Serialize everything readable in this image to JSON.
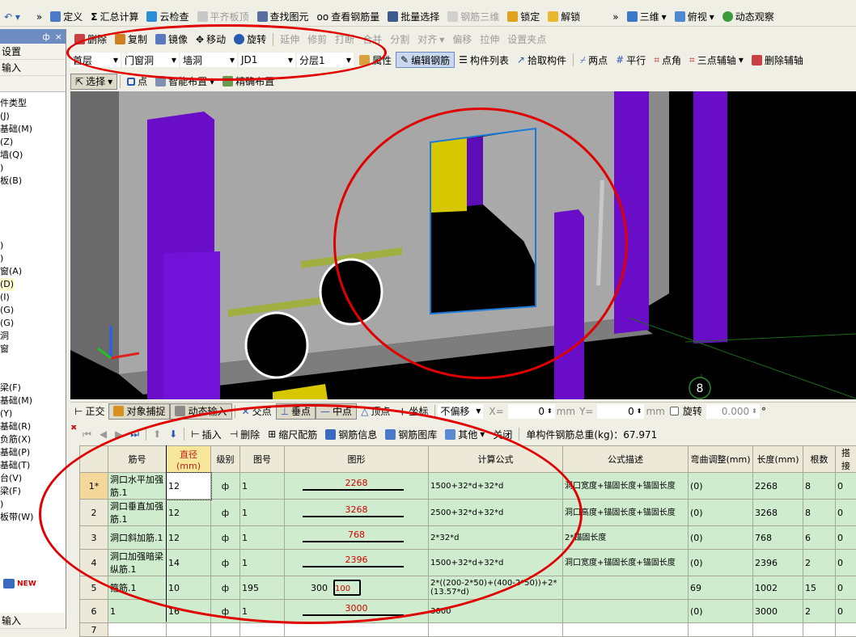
{
  "toolbar1": {
    "items": [
      "定义",
      "汇总计算",
      "云检查",
      "平齐板顶",
      "查找图元",
      "查看钢筋量",
      "批量选择",
      "钢筋三维",
      "锁定",
      "解锁"
    ],
    "view_3d": "三维",
    "view_top": "俯视",
    "view_dynamic": "动态观察"
  },
  "toolbar2": {
    "items": [
      "删除",
      "复制",
      "镜像",
      "移动",
      "旋转",
      "延伸",
      "修剪",
      "打断",
      "合并",
      "分割",
      "对齐",
      "偏移",
      "拉伸",
      "设置夹点"
    ]
  },
  "toolbar3": {
    "floor": "首层",
    "category": "门窗洞",
    "type": "墙洞",
    "element": "JD1",
    "layer": "分层1",
    "items": [
      "属性",
      "编辑钢筋",
      "构件列表",
      "拾取构件",
      "两点",
      "平行",
      "点角",
      "三点辅轴",
      "删除辅轴"
    ]
  },
  "toolbar4": {
    "select": "选择",
    "point": "点",
    "smart": "智能布置",
    "precise": "精确布置"
  },
  "left_panel": {
    "pin": "ф",
    "close": "×",
    "settings": "设置",
    "input": "输入",
    "items": [
      "件类型",
      "(J)",
      "基础(M)",
      "(Z)",
      "墙(Q)",
      ")",
      "板(B)",
      "",
      "",
      "",
      "",
      ")",
      ")",
      "窗(A)",
      "(D)",
      "(I)",
      "(G)",
      "(G)",
      "洞",
      "窗",
      "",
      "",
      "梁(F)",
      "基础(M)",
      "(Y)",
      "基础(R)",
      "负筋(X)",
      "基础(P)",
      "基础(T)",
      "台(V)",
      "梁(F)",
      ")",
      "板带(W)"
    ],
    "new_badge": "NEW",
    "bottom": "输入"
  },
  "view": {
    "axis_number": "8"
  },
  "snap_bar": {
    "items": [
      "正交",
      "对象捕捉",
      "动态输入",
      "交点",
      "垂点",
      "中点",
      "顶点",
      "坐标"
    ],
    "offset": "不偏移",
    "x_label": "X=",
    "x_value": "0",
    "y_label": "Y=",
    "y_value": "0",
    "unit": "mm",
    "rotate_label": "旋转",
    "rotate_value": "0.000",
    "degree": "°"
  },
  "rebar_toolbar": {
    "items": [
      "插入",
      "删除",
      "缩尺配筋",
      "钢筋信息",
      "钢筋图库",
      "其他",
      "关闭"
    ],
    "total_weight": "单构件钢筋总重(kg)：67.971"
  },
  "table": {
    "headers": [
      "",
      "筋号",
      "直径(mm)",
      "级别",
      "图号",
      "图形",
      "计算公式",
      "公式描述",
      "弯曲调整(mm)",
      "长度(mm)",
      "根数",
      "搭接"
    ],
    "rows": [
      {
        "num": "1*",
        "name": "洞口水平加强筋.1",
        "dia": "12",
        "grade": "ф",
        "fig": "1",
        "shape_label": "2268",
        "shape_pre": "",
        "formula": "1500+32*d+32*d",
        "desc": "洞口宽度+锚固长度+锚固长度",
        "bend": "(0)",
        "len": "2268",
        "count": "8",
        "lap": "0"
      },
      {
        "num": "2",
        "name": "洞口垂直加强筋.1",
        "dia": "12",
        "grade": "ф",
        "fig": "1",
        "shape_label": "3268",
        "shape_pre": "",
        "formula": "2500+32*d+32*d",
        "desc": "洞口高度+锚固长度+锚固长度",
        "bend": "(0)",
        "len": "3268",
        "count": "8",
        "lap": "0"
      },
      {
        "num": "3",
        "name": "洞口斜加筋.1",
        "dia": "12",
        "grade": "ф",
        "fig": "1",
        "shape_label": "768",
        "shape_pre": "",
        "formula": "2*32*d",
        "desc": "2*锚固长度",
        "bend": "(0)",
        "len": "768",
        "count": "6",
        "lap": "0"
      },
      {
        "num": "4",
        "name": "洞口加强暗梁纵筋.1",
        "dia": "14",
        "grade": "ф",
        "fig": "1",
        "shape_label": "2396",
        "shape_pre": "",
        "formula": "1500+32*d+32*d",
        "desc": "洞口宽度+锚固长度+锚固长度",
        "bend": "(0)",
        "len": "2396",
        "count": "2",
        "lap": "0"
      },
      {
        "num": "5",
        "name": "箍筋.1",
        "dia": "10",
        "grade": "ф",
        "fig": "195",
        "shape_label": "100",
        "shape_pre": "300",
        "formula": "2*((200-2*50)+(400-2*50))+2*(13.57*d)",
        "desc": "",
        "bend": "69",
        "len": "1002",
        "count": "15",
        "lap": "0"
      },
      {
        "num": "6",
        "name": "1",
        "dia": "16",
        "grade": "ф",
        "fig": "1",
        "shape_label": "3000",
        "shape_pre": "",
        "formula": "3000",
        "desc": "",
        "bend": "(0)",
        "len": "3000",
        "count": "2",
        "lap": "0"
      },
      {
        "num": "7",
        "name": "",
        "dia": "",
        "grade": "",
        "fig": "",
        "shape_label": "",
        "shape_pre": "",
        "formula": "",
        "desc": "",
        "bend": "",
        "len": "",
        "count": "",
        "lap": ""
      }
    ]
  },
  "colors": {
    "annotation": "#e00000",
    "column": "#6a0dc8",
    "wall": "#9a9a9a",
    "row_bg": "#cfeccf"
  }
}
